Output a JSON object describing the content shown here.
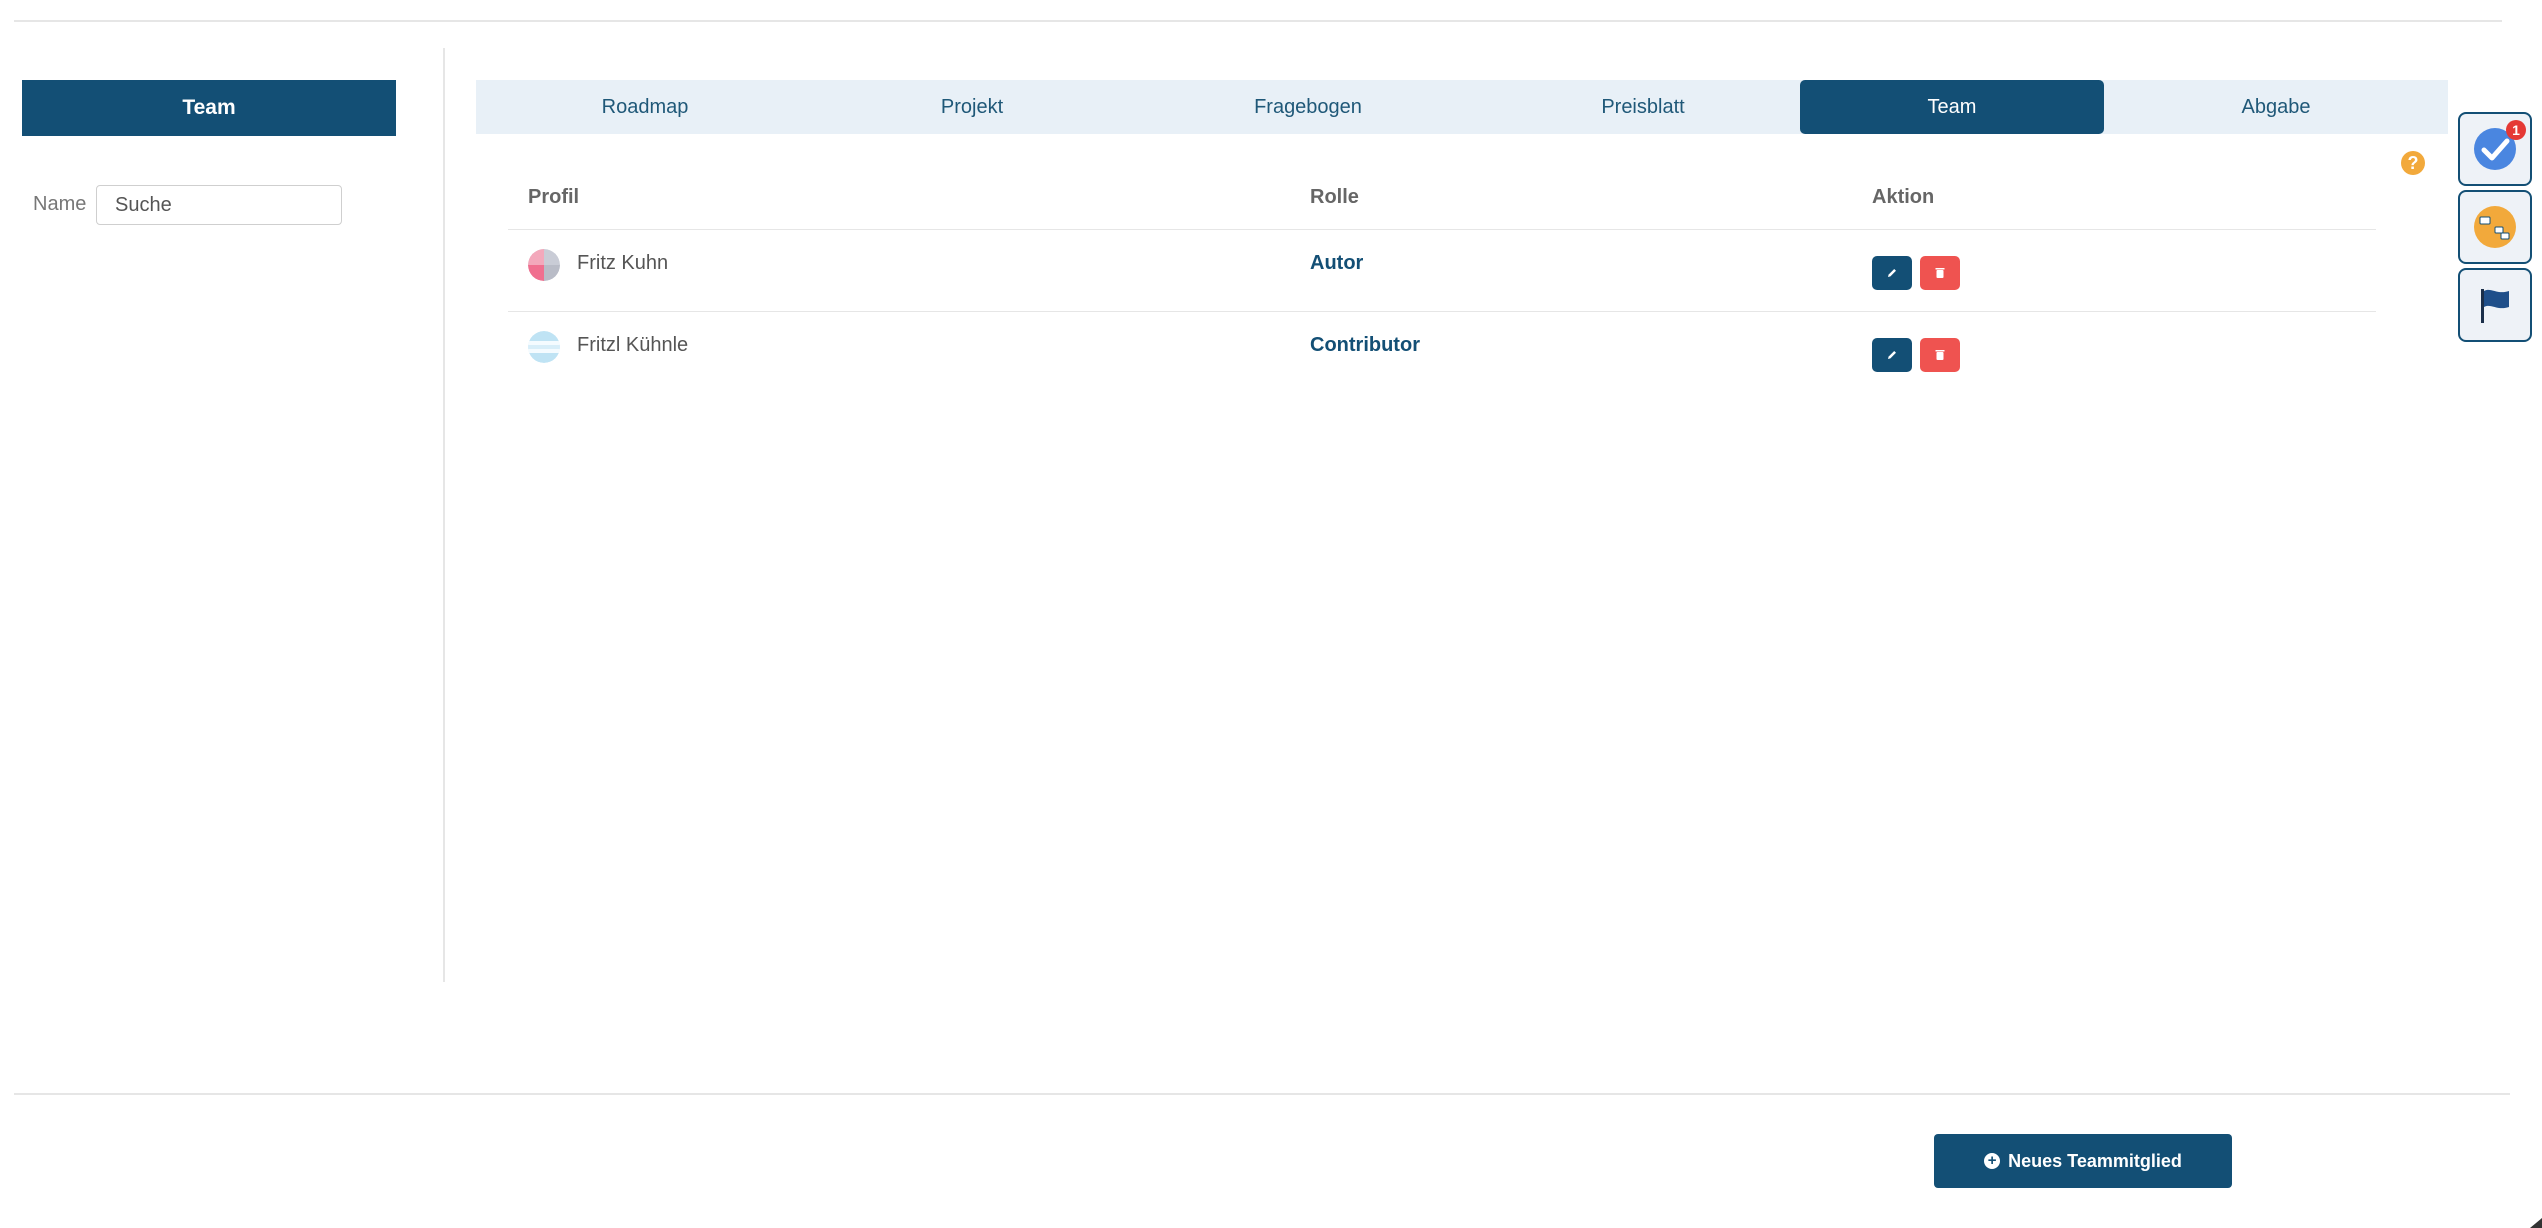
{
  "sidebar": {
    "title": "Team",
    "filter_label": "Name",
    "filter_placeholder": "Suche"
  },
  "tabs": [
    {
      "label": "Roadmap",
      "active": false
    },
    {
      "label": "Projekt",
      "active": false
    },
    {
      "label": "Fragebogen",
      "active": false
    },
    {
      "label": "Preisblatt",
      "active": false
    },
    {
      "label": "Team",
      "active": true
    },
    {
      "label": "Abgabe",
      "active": false
    }
  ],
  "table": {
    "headers": {
      "profile": "Profil",
      "role": "Rolle",
      "action": "Aktion"
    },
    "rows": [
      {
        "name": "Fritz Kuhn",
        "role": "Autor"
      },
      {
        "name": "Fritzl Kühnle",
        "role": "Contributor"
      }
    ]
  },
  "footer": {
    "new_member_label": "Neues Teammitglied"
  },
  "widgets": {
    "tasks_badge": "1"
  },
  "colors": {
    "primary": "#134f75",
    "tab_bar": "#e8f0f7",
    "danger": "#ef5350",
    "help": "#f2a93b",
    "badge": "#e53935"
  },
  "icons": [
    "help-icon",
    "pencil-icon",
    "trash-icon",
    "plus-circle-icon",
    "check-circle-icon",
    "world-map-icon",
    "flag-icon"
  ]
}
